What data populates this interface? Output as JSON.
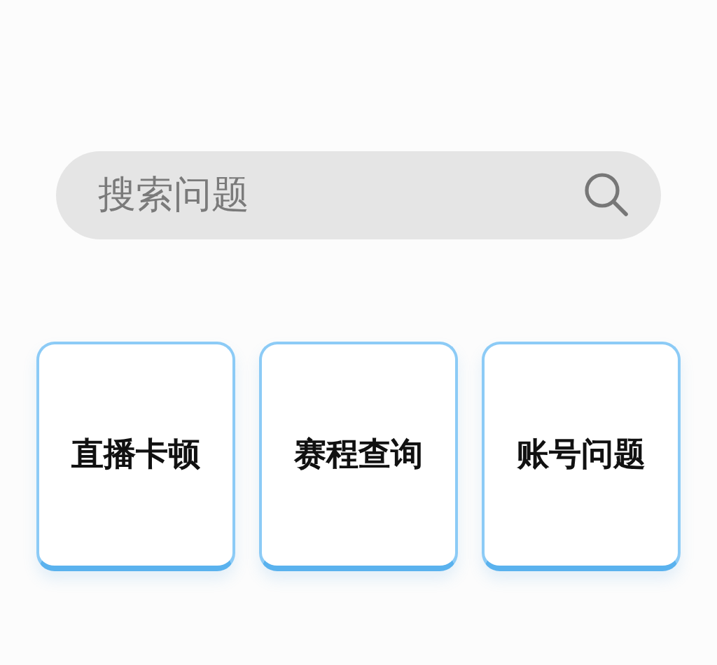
{
  "search": {
    "placeholder": "搜索问题"
  },
  "shortcuts": [
    {
      "label": "直播卡顿"
    },
    {
      "label": "赛程查询"
    },
    {
      "label": "账号问题"
    }
  ]
}
